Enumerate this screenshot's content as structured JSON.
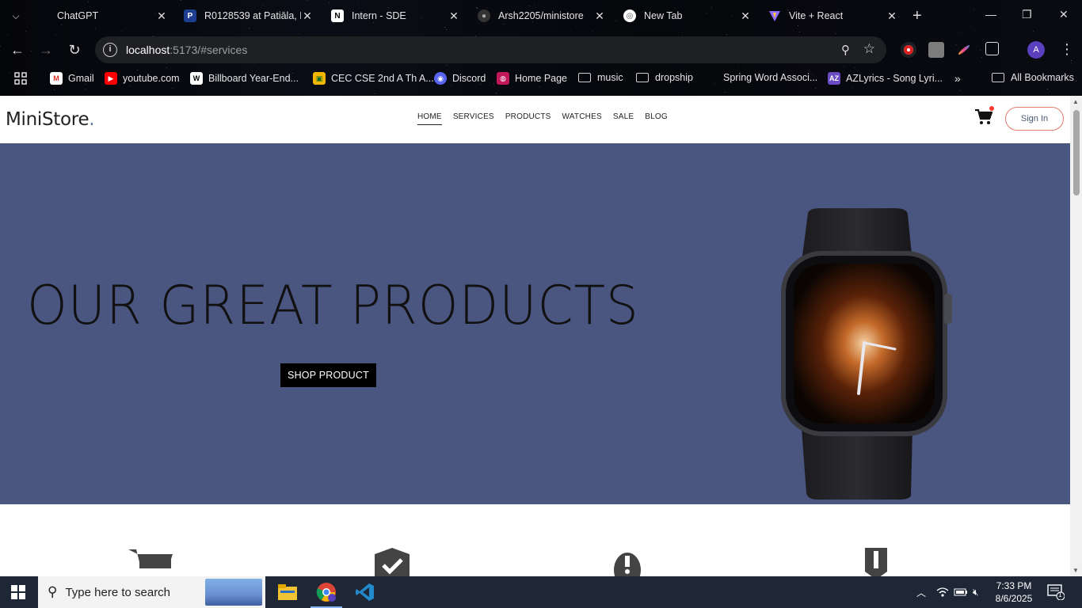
{
  "browser": {
    "tabs": [
      {
        "title": "ChatGPT",
        "favicon": "chatgpt-icon"
      },
      {
        "title": "R0128539 at Patiāla, P",
        "favicon": "paypal-like-icon"
      },
      {
        "title": "Intern - SDE",
        "favicon": "notion-n-icon"
      },
      {
        "title": "Arsh2205/ministore",
        "favicon": "github-icon"
      },
      {
        "title": "New Tab",
        "favicon": "chrome-icon"
      },
      {
        "title": "Vite + React",
        "favicon": "vite-icon"
      }
    ],
    "url_host": "localhost",
    "url_rest": ":5173/#services",
    "profile_initial": "A",
    "bookmarks": [
      {
        "label": "Gmail",
        "icon": "gmail-icon"
      },
      {
        "label": "youtube.com",
        "icon": "youtube-icon"
      },
      {
        "label": "Billboard Year-End...",
        "icon": "wikipedia-icon"
      },
      {
        "label": "CEC CSE 2nd A Th A...",
        "icon": "classroom-icon"
      },
      {
        "label": "Discord",
        "icon": "discord-icon"
      },
      {
        "label": "Home Page",
        "icon": "homepage-icon"
      },
      {
        "label": "music",
        "icon": "folder-icon"
      },
      {
        "label": "dropship",
        "icon": "folder-icon"
      },
      {
        "label": "Spring Word Associ...",
        "icon": "blank-icon"
      },
      {
        "label": "AZLyrics - Song Lyri...",
        "icon": "azlyrics-icon"
      }
    ],
    "all_bookmarks": "All Bookmarks"
  },
  "site": {
    "logo": "MiniStore",
    "logo_dot": ".",
    "nav": [
      "HOME",
      "SERVICES",
      "PRODUCTS",
      "WATCHES",
      "SALE",
      "BLOG"
    ],
    "active_nav": "HOME",
    "signin": "Sign In",
    "hero": {
      "title": "OUR GREAT PRODUCTS",
      "cta": "SHOP PRODUCT",
      "background": "#4a5580"
    },
    "service_icons": [
      "shopping-cart-icon",
      "shield-check-icon",
      "alert-bell-icon",
      "bookmark-shield-icon"
    ]
  },
  "taskbar": {
    "search_placeholder": "Type here to search",
    "time": "7:33 PM",
    "date": "8/6/2025",
    "notification_count": "1"
  }
}
